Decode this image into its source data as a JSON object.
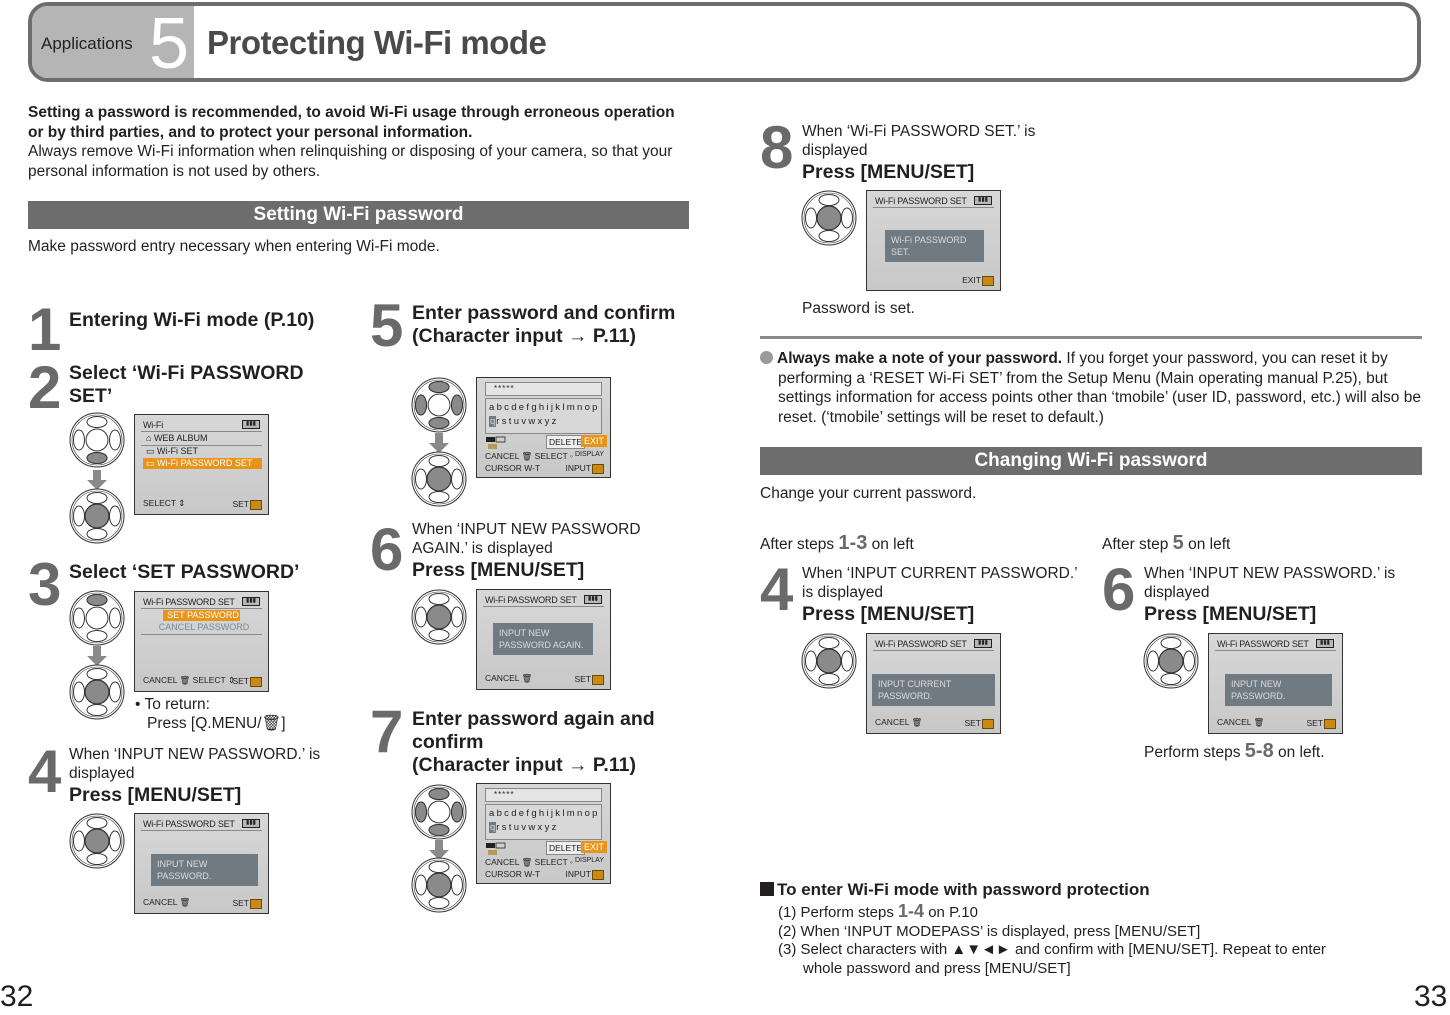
{
  "header": {
    "section_label": "Applications",
    "section_number": "5",
    "title": "Protecting Wi-Fi mode"
  },
  "intro": {
    "bold": "Setting a password is recommended, to avoid Wi-Fi usage through erroneous operation or by third parties, and to protect your personal information.",
    "normal": "Always remove Wi-Fi information when relinquishing or disposing of your camera, so that your personal information is not used by others."
  },
  "setting_section": {
    "bar_title": "Setting Wi-Fi password",
    "description": "Make password entry necessary when entering Wi-Fi mode.",
    "steps": [
      {
        "num": "1",
        "heading": "Entering Wi-Fi mode (P.10)"
      },
      {
        "num": "2",
        "heading": "Select ‘Wi-Fi PASSWORD SET’",
        "screen": {
          "title": "Wi-Fi",
          "items": [
            "WEB ALBUM",
            "Wi-Fi SET",
            "Wi-Fi PASSWORD SET"
          ],
          "selected": "Wi-Fi PASSWORD SET",
          "footer_left": "SELECT ⇕",
          "footer_right": "SET"
        }
      },
      {
        "num": "3",
        "heading": "Select ‘SET PASSWORD’",
        "screen": {
          "title": "Wi-Fi PASSWORD SET",
          "items": [
            "SET PASSWORD",
            "CANCEL PASSWORD"
          ],
          "selected": "SET PASSWORD",
          "footer_left": "CANCEL 🗑 SELECT ⇕",
          "footer_right": "SET"
        },
        "note_line1": "• To return:",
        "note_line2": "Press [Q.MENU/🗑]"
      },
      {
        "num": "4",
        "intro": "When ‘INPUT NEW PASSWORD.’ is displayed",
        "action": "Press [MENU/SET]",
        "screen": {
          "title": "Wi-Fi PASSWORD SET",
          "message": "INPUT NEW PASSWORD.",
          "footer_left": "CANCEL 🗑",
          "footer_right": "SET"
        }
      },
      {
        "num": "5",
        "heading": "Enter password and confirm",
        "heading2": "(Character input → P.11)",
        "screen": {
          "masked": "*****",
          "row1": "abcdefghijklmnop",
          "row2_sel": "q",
          "row2": "rstuvwxyz",
          "delete": "DELETE",
          "exit": "EXIT",
          "l1": "CANCEL 🗑 SELECT ◦",
          "l2": "CURSOR W-T",
          "r1": "DISPLAY",
          "r2": "INPUT"
        }
      },
      {
        "num": "6",
        "intro": "When ‘INPUT NEW PASSWORD AGAIN.’ is displayed",
        "action": "Press [MENU/SET]",
        "screen": {
          "title": "Wi-Fi PASSWORD SET",
          "message": "INPUT NEW PASSWORD AGAIN.",
          "footer_left": "CANCEL 🗑",
          "footer_right": "SET"
        }
      },
      {
        "num": "7",
        "heading": "Enter password again and confirm",
        "heading2": "(Character input → P.11)",
        "screen": {
          "masked": "*****",
          "row1": "abcdefghijklmnop",
          "row2_sel": "q",
          "row2": "rstuvwxyz",
          "delete": "DELETE",
          "exit": "EXIT",
          "l1": "CANCEL 🗑 SELECT ◦",
          "l2": "CURSOR W-T",
          "r1": "DISPLAY",
          "r2": "INPUT"
        }
      },
      {
        "num": "8",
        "intro": "When ‘Wi-Fi PASSWORD SET.’ is displayed",
        "action": "Press [MENU/SET]",
        "screen": {
          "title": "Wi-Fi PASSWORD SET",
          "message": "Wi-Fi PASSWORD SET.",
          "footer_right": "EXIT"
        },
        "result": "Password is set."
      }
    ]
  },
  "note": {
    "bold": "Always make a note of your password.",
    "text": " If you forget your password, you can reset it by performing a ‘RESET Wi-Fi SET’ from the Setup Menu (Main operating manual P.25), but settings information for access points other than ‘tmobile’ (user ID, password, etc.) will also be reset. (‘tmobile’ settings will be reset to default.)"
  },
  "changing_section": {
    "bar_title": "Changing Wi-Fi password",
    "description": "Change your current password.",
    "left": {
      "after_prefix": "After steps ",
      "after_num": "1-3",
      "after_suffix": " on left",
      "num": "4",
      "intro": "When ‘INPUT CURRENT PASSWORD.’ is displayed",
      "action": "Press [MENU/SET]",
      "screen": {
        "title": "Wi-Fi PASSWORD SET",
        "message": "INPUT CURRENT PASSWORD.",
        "footer_left": "CANCEL 🗑",
        "footer_right": "SET"
      }
    },
    "right": {
      "after_prefix": "After step ",
      "after_num": "5",
      "after_suffix": " on left",
      "num": "6",
      "intro": "When ‘INPUT NEW PASSWORD.’ is displayed",
      "action": "Press [MENU/SET]",
      "screen": {
        "title": "Wi-Fi PASSWORD SET",
        "message": "INPUT NEW PASSWORD.",
        "footer_left": "CANCEL 🗑",
        "footer_right": "SET"
      },
      "perform_prefix": "Perform steps ",
      "perform_num": "5-8",
      "perform_suffix": " on left."
    }
  },
  "protection": {
    "title": "To enter Wi-Fi mode with password protection",
    "items": [
      {
        "prefix": "(1) Perform steps ",
        "num": "1-4",
        "suffix": " on P.10"
      },
      {
        "text": "(2) When ‘INPUT MODEPASS’ is displayed, press [MENU/SET]"
      },
      {
        "text": "(3) Select characters with ▲▼◄► and confirm with [MENU/SET]. Repeat to enter"
      },
      {
        "text": "whole password and press [MENU/SET]"
      }
    ]
  },
  "page_numbers": {
    "left": "32",
    "right": "33"
  },
  "colors": {
    "header_gray": "#6d6d6d",
    "tab_gray": "#b5b5b5",
    "bar_gray": "#6d6d6d",
    "highlight_orange": "#e8941a",
    "step_num_gray": "#6a6a6a"
  }
}
